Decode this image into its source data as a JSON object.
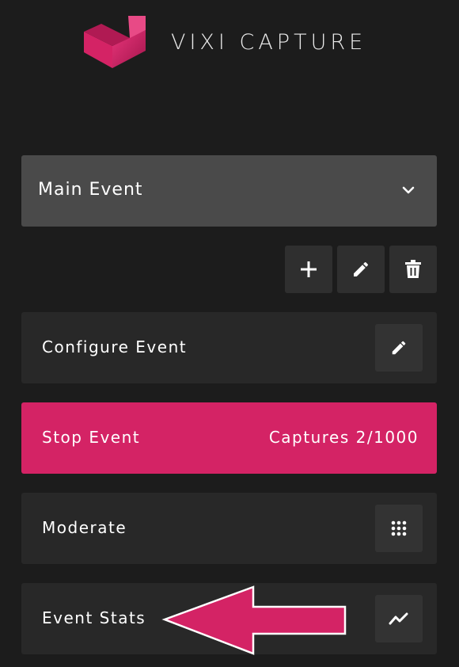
{
  "brand": {
    "name": "VIXI CAPTURE",
    "logo_icon": "vixi-logo-mark",
    "accent_color": "#d42365"
  },
  "event_selector": {
    "selected": "Main Event",
    "icon": "chevron-down-icon"
  },
  "event_actions": [
    {
      "name": "add-event-button",
      "icon": "plus-icon"
    },
    {
      "name": "edit-event-button",
      "icon": "pencil-icon"
    },
    {
      "name": "delete-event-button",
      "icon": "trash-icon"
    }
  ],
  "rows": {
    "configure": {
      "label": "Configure Event",
      "icon": "pencil-icon"
    },
    "stop": {
      "label": "Stop Event",
      "captures": "Captures 2/1000",
      "color": "#d42365"
    },
    "moderate": {
      "label": "Moderate",
      "icon": "grid-icon"
    },
    "stats": {
      "label": "Event Stats",
      "icon": "trend-line-icon"
    }
  },
  "annotation": {
    "icon": "pointer-arrow-icon",
    "color": "#d42365"
  }
}
